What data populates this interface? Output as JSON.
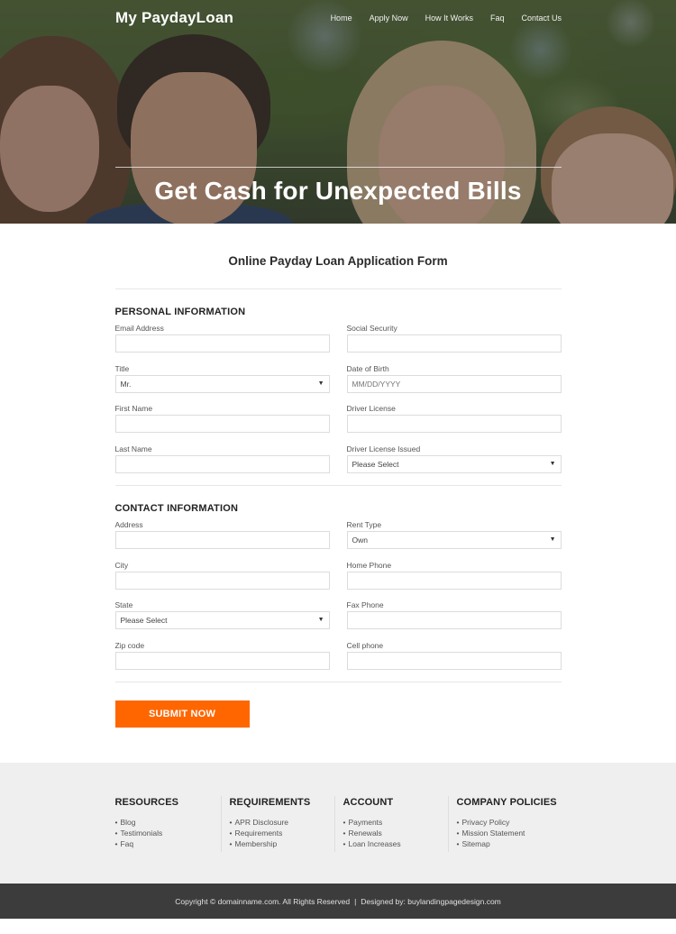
{
  "header": {
    "logo": "My PaydayLoan",
    "nav": [
      {
        "label": "Home"
      },
      {
        "label": "Apply Now"
      },
      {
        "label": "How It Works"
      },
      {
        "label": "Faq"
      },
      {
        "label": "Contact Us"
      }
    ],
    "hero_title": "Get Cash for Unexpected Bills"
  },
  "form": {
    "title": "Online Payday Loan Application Form",
    "personal": {
      "heading": "PERSONAL INFORMATION",
      "email": {
        "label": "Email Address",
        "value": ""
      },
      "ssn": {
        "label": "Social Security",
        "value": ""
      },
      "title": {
        "label": "Title",
        "selected": "Mr."
      },
      "dob": {
        "label": "Date of Birth",
        "placeholder": "MM/DD/YYYY"
      },
      "first_name": {
        "label": "First Name",
        "value": ""
      },
      "driver_license": {
        "label": "Driver License",
        "value": ""
      },
      "last_name": {
        "label": "Last Name",
        "value": ""
      },
      "license_issued": {
        "label": "Driver License Issued",
        "selected": "Please Select"
      }
    },
    "contact": {
      "heading": "CONTACT INFORMATION",
      "address": {
        "label": "Address",
        "value": ""
      },
      "rent_type": {
        "label": "Rent Type",
        "selected": "Own"
      },
      "city": {
        "label": "City",
        "value": ""
      },
      "home_phone": {
        "label": "Home Phone",
        "value": ""
      },
      "state": {
        "label": "State",
        "selected": "Please Select"
      },
      "fax_phone": {
        "label": "Fax Phone",
        "value": ""
      },
      "zip": {
        "label": "Zip code",
        "value": ""
      },
      "cell_phone": {
        "label": "Cell phone",
        "value": ""
      }
    },
    "submit_label": "SUBMIT NOW",
    "dropdown_icon": "▼"
  },
  "footer": {
    "columns": [
      {
        "heading": "RESOURCES",
        "items": [
          "Blog",
          "Testimonials",
          "Faq"
        ]
      },
      {
        "heading": "REQUIREMENTS",
        "items": [
          "APR Disclosure",
          "Requirements",
          "Membership"
        ]
      },
      {
        "heading": "ACCOUNT",
        "items": [
          "Payments",
          "Renewals",
          "Loan Increases"
        ]
      },
      {
        "heading": "COMPANY POLICIES",
        "items": [
          "Privacy Policy",
          "Mission Statement",
          "Sitemap"
        ]
      }
    ],
    "bullet": "•",
    "copyright": "Copyright © domainname.com. All Rights Reserved",
    "separator": "|",
    "designed_by": "Designed by: buylandingpagedesign.com"
  },
  "colors": {
    "accent": "#ff6600",
    "footer_bg": "#efefef",
    "bottom_bar_bg": "#3c3c3c"
  }
}
